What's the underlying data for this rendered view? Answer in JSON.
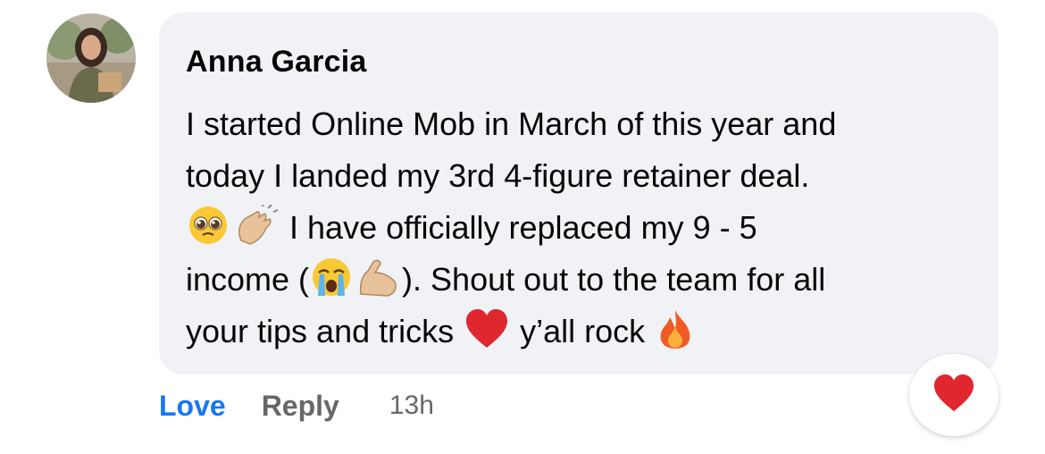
{
  "comment": {
    "author": "Anna Garcia",
    "lines": [
      "I started Online Mob in March of this year and",
      "today I landed my 3rd 4-figure retainer deal.",
      "I have officially replaced my 9 - 5",
      "income (",
      "). Shout out to the team for all",
      "your tips and tricks",
      "y’all rock"
    ],
    "emojis": [
      "pleading-face",
      "clapping-hands",
      "crying-face",
      "flexed-biceps",
      "red-heart",
      "fire"
    ]
  },
  "actions": {
    "love_label": "Love",
    "reply_label": "Reply",
    "timestamp": "13h"
  },
  "reaction": {
    "icon": "red-heart-icon"
  },
  "colors": {
    "accent": "#1877f2",
    "muted": "#65676b",
    "bubble": "#f0f2f5",
    "heart": "#e0262f"
  }
}
